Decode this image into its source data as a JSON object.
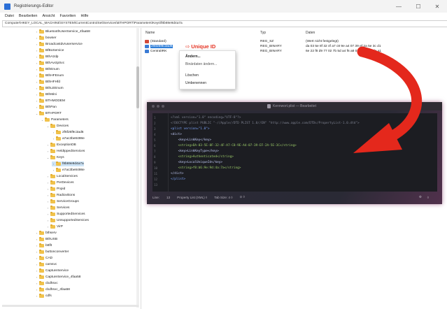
{
  "window": {
    "title": "Registrierungs-Editor",
    "min": "—",
    "max": "☐",
    "close": "✕"
  },
  "menu": [
    "Datei",
    "Bearbeiten",
    "Ansicht",
    "Favoriten",
    "Hilfe"
  ],
  "address": "Computer\\HKEY_LOCAL_MACHINE\\SYSTEM\\CurrentControlSet\\Services\\BTHPORT\\Parameters\\Keys\\f8b69e9d4a7a",
  "tree": [
    "BluetoothUserService_4faa58",
    "bowser",
    "Broadcastdvruserservice",
    "BfBoService",
    "BthA2dp",
    "BthAvctpSvc",
    "BthEnum",
    "BthHFEnum",
    "BthHFHfd",
    "BthLEEnum",
    "BthMini",
    "BTHMODEM",
    "BthPan",
    "BTHPORT",
    "Parameters",
    "Devices",
    "2f6f26f9c3ad6",
    "a7ac3be8498e",
    "ExceptionDB",
    "HeldIppedServices",
    "Keys",
    "f8b69e9d4a7a",
    "e7ac3be8498e",
    "LocalServices",
    "PerDevices",
    "Pnpid",
    "Radiovitions",
    "ServiceGroups",
    "Services",
    "SupportedServices",
    "UnsupportedServices",
    "VirP",
    "bthserv",
    "BthUSB",
    "bttflt",
    "buttonconverter",
    "CAD",
    "camsvc",
    "CaptureService",
    "CaptureService_4faa58",
    "cbdhsvc",
    "cbdhsvc_4faa58",
    "cdfs"
  ],
  "list": {
    "headers": {
      "name": "Name",
      "type": "Typ",
      "data": "Daten"
    },
    "rows": [
      {
        "name": "(Standard)",
        "type": "REG_SZ",
        "data": "(Wert nicht festgelegt)"
      },
      {
        "name": "2f6f26f9c3ad6",
        "type": "REG_BINARY",
        "data": "da 03 5e 8f 32 4f a7 c8 9e a4 07 39 ef 2a 5e 3c d1"
      },
      {
        "name": "CentralIRK",
        "type": "REG_BINARY",
        "data": "6e 22 f8 d9 77 02 7b 5d a4 f6 a8 02 21 77 7b fe a1"
      }
    ]
  },
  "annotation": {
    "arrow": "⇨",
    "text": "Unique ID"
  },
  "context_menu": [
    "Ändern...",
    "Binärdaten ändern...",
    "Löschen",
    "Umbenennen"
  ],
  "editor": {
    "title": "Kennwort.plist — Bearbeitet",
    "lines": [
      {
        "n": "1",
        "code": "<?xml version=\"1.0\" encoding=\"UTF-8\"?>"
      },
      {
        "n": "2",
        "code": "<!DOCTYPE plist PUBLIC \"-//Apple//DTD PLIST 1.0//EN\" \"http://www.apple.com/DTDs/PropertyList-1.0.dtd\">"
      },
      {
        "n": "3",
        "code": "<plist version=\"1.0\">"
      },
      {
        "n": "4",
        "code": "<dict>"
      },
      {
        "n": "5",
        "code": "    <key>LinkKey</key>"
      },
      {
        "n": "6",
        "code": "    <string>DA-03-5E-8F-32-4F-A7-C8-9E-A4-07-39-EF-2A-5E-3C</string>"
      },
      {
        "n": "7",
        "code": "    <key>LinkKeyType</key>"
      },
      {
        "n": "8",
        "code": "    <string>Authenticated</string>"
      },
      {
        "n": "9",
        "code": "    <key>LocalUniqueId</key>"
      },
      {
        "n": "10",
        "code": "    <string>f8:b6:9e:9d:4a:7a</string>"
      },
      {
        "n": "11",
        "code": "</dict>"
      },
      {
        "n": "12",
        "code": "</plist>"
      },
      {
        "n": "13",
        "code": ""
      }
    ],
    "status": {
      "line": "Line:",
      "col": "13",
      "syntax": "Property List (XML) ◊",
      "tab": "Tab Size: 4 ◊",
      "spell": "⊙ ◊",
      "gear": "⚙",
      "right": "◊"
    }
  }
}
